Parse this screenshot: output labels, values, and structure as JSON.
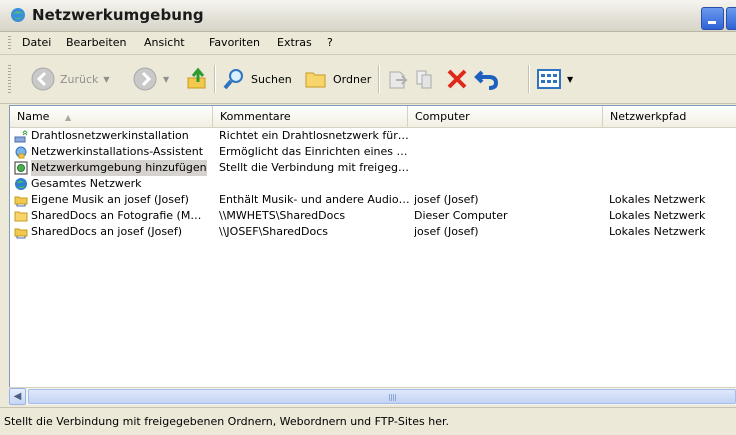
{
  "window": {
    "title": "Netzwerkumgebung"
  },
  "menu": [
    "Datei",
    "Bearbeiten",
    "Ansicht",
    "Favoriten",
    "Extras",
    "?"
  ],
  "toolbar": {
    "back_label": "Zurück",
    "search_label": "Suchen",
    "folders_label": "Ordner"
  },
  "columns": [
    "Name",
    "Kommentare",
    "Computer",
    "Netzwerkpfad"
  ],
  "rows": [
    {
      "icon": "wireless-setup-icon",
      "name": "Drahtlosnetzwerkinstallation",
      "comment": "Richtet ein Drahtlosnetzwerk für…",
      "computer": "",
      "path": ""
    },
    {
      "icon": "network-wizard-icon",
      "name": "Netzwerkinstallations-Assistent",
      "comment": "Ermöglicht das Einrichten eines …",
      "computer": "",
      "path": ""
    },
    {
      "icon": "add-network-place-icon",
      "name": "Netzwerkumgebung hinzufügen",
      "comment": "Stellt die Verbindung mit freigeg…",
      "computer": "",
      "path": "",
      "selected": true
    },
    {
      "icon": "globe-icon",
      "name": "Gesamtes Netzwerk",
      "comment": "",
      "computer": "",
      "path": ""
    },
    {
      "icon": "network-folder-icon",
      "name": "Eigene Musik an josef (Josef)",
      "comment": "Enthält Musik- und andere Audio…",
      "computer": "josef (Josef)",
      "path": "Lokales Netzwerk"
    },
    {
      "icon": "folder-icon",
      "name": "SharedDocs an Fotografie (M…",
      "comment": "\\\\MWHETS\\SharedDocs",
      "computer": "Dieser Computer",
      "path": "Lokales Netzwerk"
    },
    {
      "icon": "network-folder-icon",
      "name": "SharedDocs an josef (Josef)",
      "comment": "\\\\JOSEF\\SharedDocs",
      "computer": "josef (Josef)",
      "path": "Lokales Netzwerk"
    }
  ],
  "status": {
    "text": "Stellt die Verbindung mit freigegebenen Ordnern, Webordnern und FTP-Sites her."
  }
}
